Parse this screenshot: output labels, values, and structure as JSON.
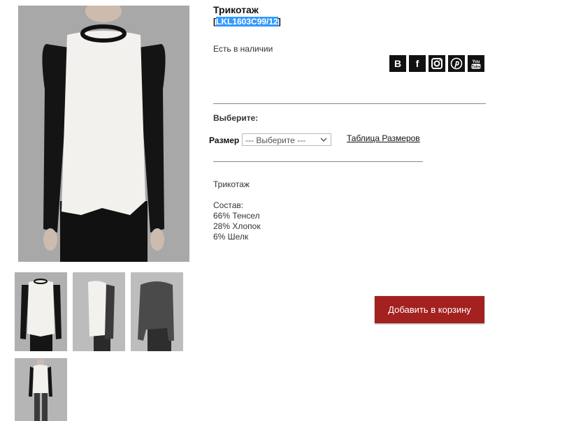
{
  "product": {
    "title": "Трикотаж",
    "sku_open": "[",
    "sku": "LKL1603C99/12",
    "sku_close": "]",
    "stock": "Есть в наличии"
  },
  "social": {
    "vk_label": "B",
    "fb_label": "f"
  },
  "options": {
    "heading": "Выберите:",
    "size_label": "Размер",
    "size_select_value": "--- Выберите ---",
    "size_table_link": "Таблица Размеров"
  },
  "description": {
    "name": "Трикотаж",
    "composition_title": "Состав:",
    "lines": [
      "66% Тенсел",
      "28% Хлопок",
      "6% Шелк"
    ]
  },
  "cart": {
    "add_label": "Добавить в корзину"
  },
  "colors": {
    "button": "#a3211f",
    "highlight": "#3399ff"
  }
}
